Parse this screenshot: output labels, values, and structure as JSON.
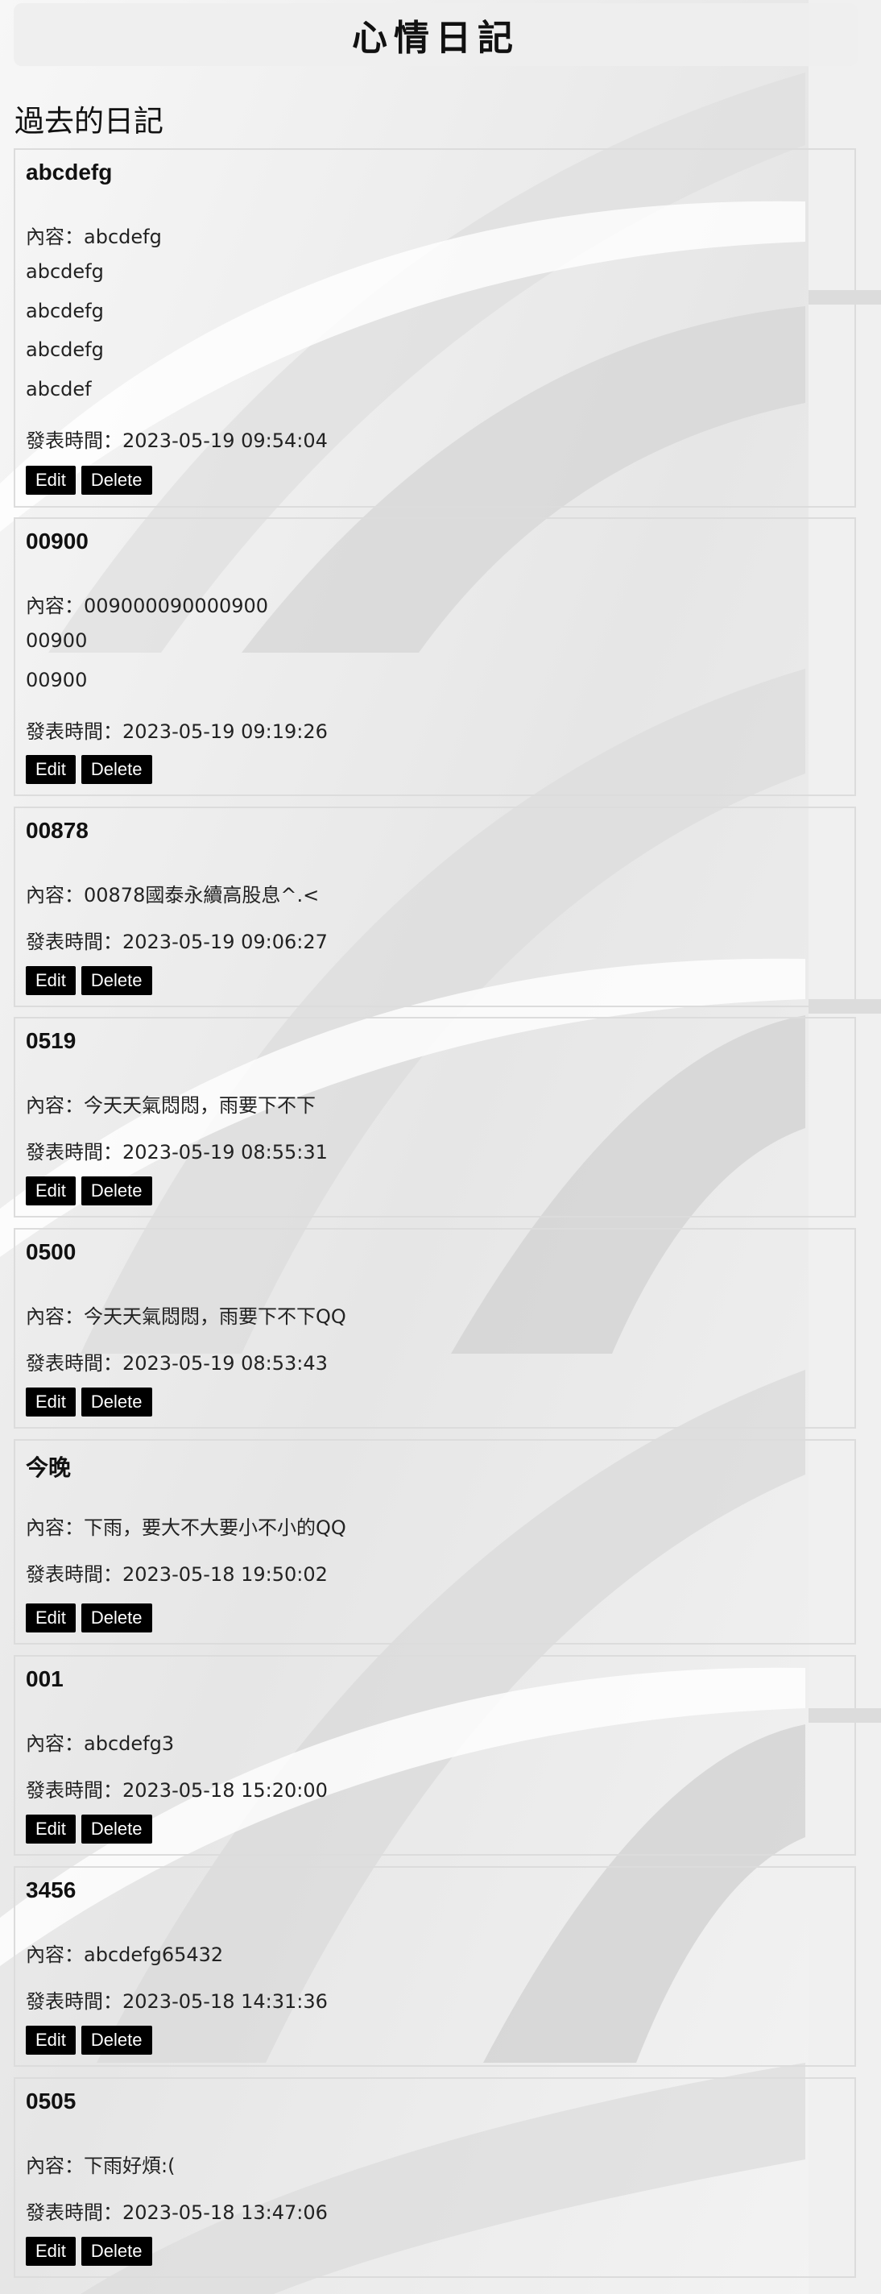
{
  "header": {
    "title": "心情日記"
  },
  "section": {
    "title": "過去的日記"
  },
  "content_prefix": "內容：",
  "time_prefix": "發表時間：",
  "buttons": {
    "edit": "Edit",
    "delete": "Delete"
  },
  "entries": [
    {
      "title": "abcdefg",
      "content": [
        "abcdefg",
        "abcdefg",
        "abcdefg",
        "abcdefg",
        "abcdef"
      ],
      "time": "2023-05-19 09:54:04"
    },
    {
      "title": "00900",
      "content": [
        "009000090000900",
        "00900",
        "00900"
      ],
      "time": "2023-05-19 09:19:26"
    },
    {
      "title": "00878",
      "content": [
        "00878國泰永續高股息^.<"
      ],
      "time": "2023-05-19 09:06:27"
    },
    {
      "title": "0519",
      "content": [
        "今天天氣悶悶，雨要下不下"
      ],
      "time": "2023-05-19 08:55:31"
    },
    {
      "title": "0500",
      "content": [
        "今天天氣悶悶，雨要下不下QQ"
      ],
      "time": "2023-05-19 08:53:43"
    },
    {
      "title": "今晚",
      "content": [
        "下雨，要大不大要小不小的QQ"
      ],
      "time": "2023-05-18 19:50:02"
    },
    {
      "title": "001",
      "content": [
        "abcdefg3"
      ],
      "time": "2023-05-18 15:20:00"
    },
    {
      "title": "3456",
      "content": [
        "abcdefg65432"
      ],
      "time": "2023-05-18 14:31:36"
    },
    {
      "title": "0505",
      "content": [
        "下雨好煩:("
      ],
      "time": "2023-05-18 13:47:06"
    }
  ]
}
